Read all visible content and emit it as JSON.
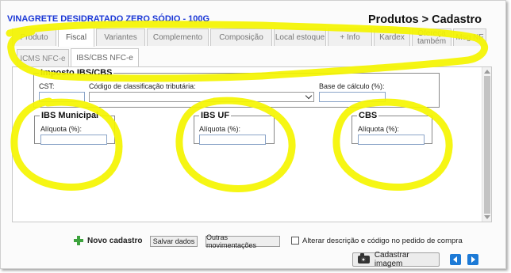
{
  "header": {
    "product_name": "VINAGRETE DESIDRATADO ZERO SÓDIO - 100G",
    "breadcrumb": "Produtos > Cadastro"
  },
  "main_tabs": [
    {
      "label": "Produto",
      "active": false
    },
    {
      "label": "Fiscal",
      "active": true
    },
    {
      "label": "Variantes",
      "active": false
    },
    {
      "label": "Complemento",
      "active": false
    },
    {
      "label": "Composição",
      "active": false
    },
    {
      "label": "Local estoque",
      "active": false
    },
    {
      "label": "+ Info",
      "active": false
    },
    {
      "label": "Kardex",
      "active": false
    },
    {
      "label": "Ofereça também",
      "active": false
    },
    {
      "label": "Msg NF",
      "active": false
    }
  ],
  "sub_tabs": [
    {
      "label": "ICMS NFC-e",
      "active": false
    },
    {
      "label": "IBS/CBS NFC-e",
      "active": true
    }
  ],
  "imposto": {
    "legend": "Imposto IBS/CBS",
    "cst_label": "CST:",
    "cst_value": "",
    "classificacao_label": "Código de classificação tributária:",
    "classificacao_value": "",
    "base_label": "Base de cálculo (%):",
    "base_value": ""
  },
  "groups": [
    {
      "legend": "IBS Municipal",
      "aliquota_label": "Alíquota (%):",
      "aliquota_value": ""
    },
    {
      "legend": "IBS UF",
      "aliquota_label": "Alíquota (%):",
      "aliquota_value": ""
    },
    {
      "legend": "CBS",
      "aliquota_label": "Alíquota (%):",
      "aliquota_value": ""
    }
  ],
  "footer": {
    "novo_cadastro": "Novo cadastro",
    "salvar_dados": "Salvar dados",
    "outras_movimentacoes": "Outras movimentações",
    "alterar_checkbox_label": "Alterar descrição e código no pedido de compra",
    "alterar_checked": false,
    "cadastrar_imagem": "Cadastrar imagem"
  },
  "icons": {
    "add": "plus-icon",
    "camera": "camera-icon",
    "prev": "arrow-left-icon",
    "next": "arrow-right-icon"
  },
  "colors": {
    "product_title": "#1a37d6",
    "highlight": "#f5f500",
    "nav_button": "#1d7ad6",
    "add_icon": "#3ea33e"
  }
}
